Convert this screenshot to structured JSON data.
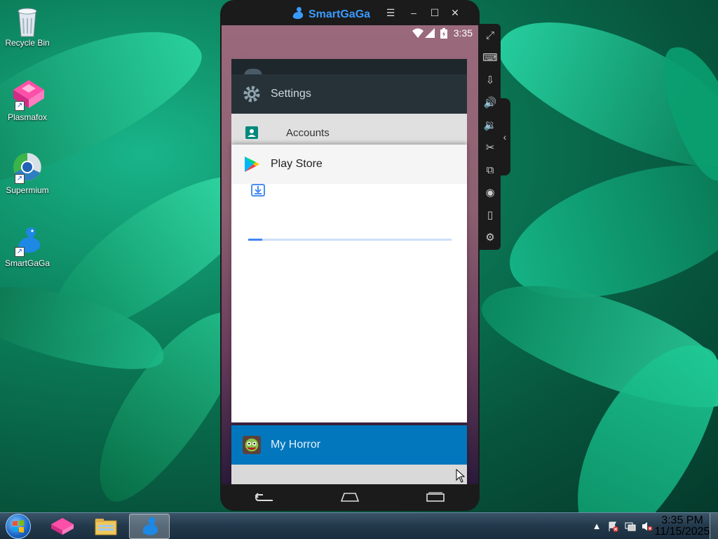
{
  "desktop": {
    "icons": [
      {
        "label": "Recycle Bin",
        "icon": "recycle-bin-icon"
      },
      {
        "label": "Plasmafox",
        "icon": "plasmafox-icon"
      },
      {
        "label": "Supermium",
        "icon": "supermium-icon"
      },
      {
        "label": "SmartGaGa",
        "icon": "smartgaga-icon"
      }
    ]
  },
  "emulator": {
    "title": "SmartGaGa",
    "title_buttons": {
      "menu": "☰",
      "minimize": "–",
      "maximize": "☐",
      "close": "✕"
    },
    "status_bar": {
      "time": "3:35"
    },
    "recents": {
      "settings": {
        "title": "Settings",
        "row_label": "Accounts"
      },
      "play_store": {
        "title": "Play Store",
        "progress": 0.07
      },
      "my_horror": {
        "title": "My Horror"
      }
    },
    "sidebar": [
      "fullscreen-icon",
      "keyboard-icon",
      "install-apk-icon",
      "volume-up-icon",
      "volume-down-icon",
      "screenshot-cut-icon",
      "multi-instance-icon",
      "location-icon",
      "shake-icon",
      "settings-icon"
    ]
  },
  "taskbar": {
    "apps": [
      "plasmafox-icon",
      "file-explorer-icon",
      "smartgaga-icon"
    ],
    "clock": {
      "time": "3:35 PM",
      "date": "11/15/2025"
    }
  },
  "colors": {
    "settings_header": "#263238",
    "horror_header": "#0277bd",
    "progress": "#4285f4"
  }
}
